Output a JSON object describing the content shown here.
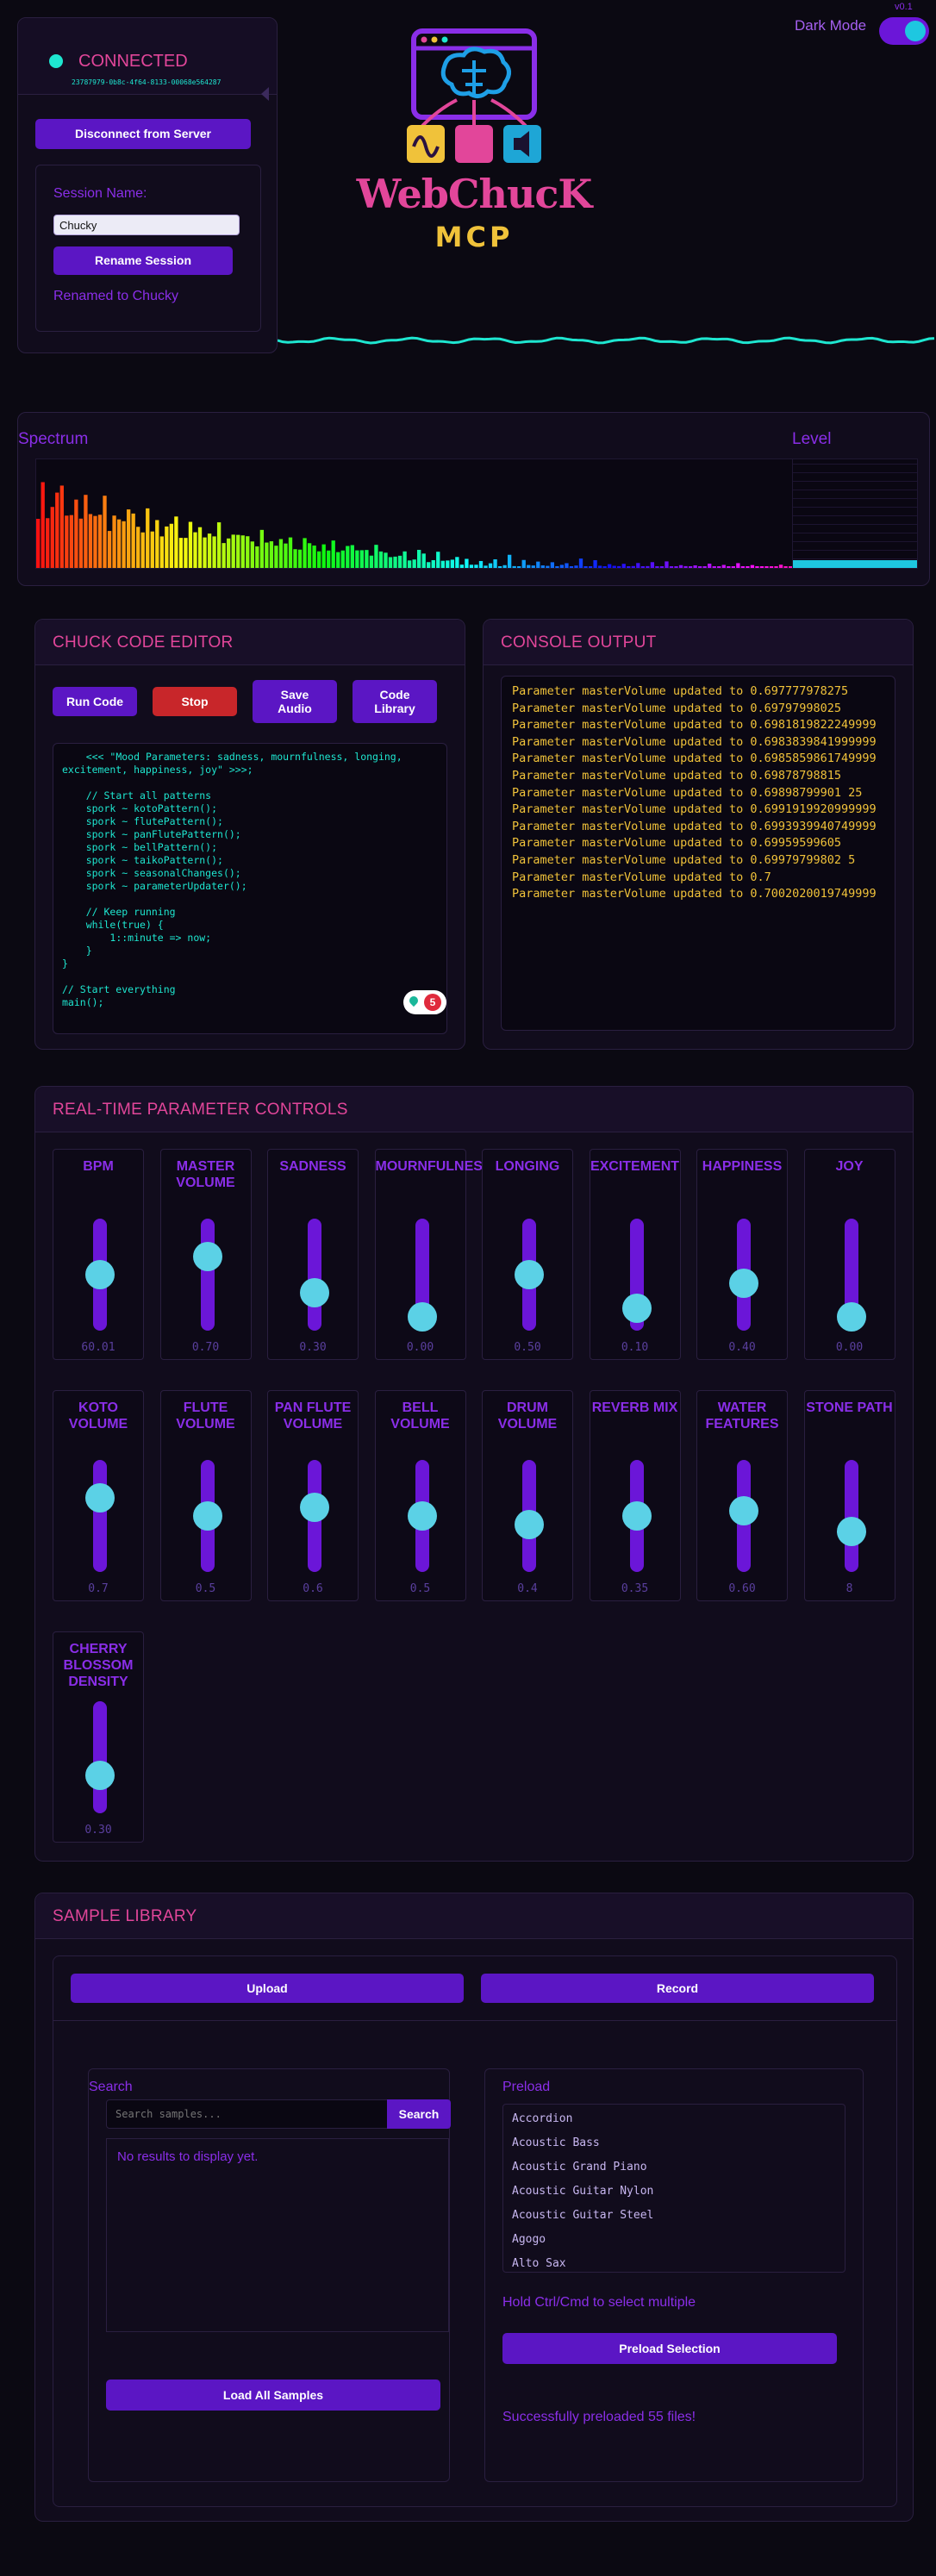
{
  "connection": {
    "status": "CONNECTED",
    "id": "23787979-0b8c-4f64-8133-00068e564287",
    "disconnect_label": "Disconnect from Server"
  },
  "session": {
    "label": "Session Name:",
    "value": "Chucky",
    "rename_label": "Rename Session",
    "message": "Renamed to Chucky"
  },
  "header": {
    "version": "v0.1",
    "dark_mode_label": "Dark Mode",
    "logo_title": "WebChucK",
    "logo_subtitle": "MCP"
  },
  "analyzers": {
    "spectrum_title": "Spectrum",
    "level_title": "Level",
    "level_value": 0.07
  },
  "editor": {
    "title": "CHUCK CODE EDITOR",
    "run_label": "Run Code",
    "stop_label": "Stop",
    "save_label": "Save Audio",
    "library_label": "Code Library",
    "code": "    <<< \"Mood Parameters: sadness, mournfulness, longing, excitement, happiness, joy\" >>>;\n\n    // Start all patterns\n    spork ~ kotoPattern();\n    spork ~ flutePattern();\n    spork ~ panFlutePattern();\n    spork ~ bellPattern();\n    spork ~ taikoPattern();\n    spork ~ seasonalChanges();\n    spork ~ parameterUpdater();\n\n    // Keep running\n    while(true) {\n        1::minute => now;\n    }\n}\n\n// Start everything\nmain();",
    "badge_count": "5"
  },
  "console": {
    "title": "CONSOLE OUTPUT",
    "lines": [
      "Parameter masterVolume updated to 0.697777978275",
      "Parameter masterVolume updated to 0.69797998025",
      "Parameter masterVolume updated to 0.6981819822249999",
      "Parameter masterVolume updated to 0.6983839841999999",
      "Parameter masterVolume updated to 0.6985859861749999",
      "Parameter masterVolume updated to 0.69878798815",
      "Parameter masterVolume updated to 0.69898799901 25",
      "Parameter masterVolume updated to 0.6991919920999999",
      "Parameter masterVolume updated to 0.6993939940749999",
      "Parameter masterVolume updated to 0.69959599605",
      "Parameter masterVolume updated to 0.69979799802 5",
      "Parameter masterVolume updated to 0.7",
      "Parameter masterVolume updated to 0.7002020019749999"
    ]
  },
  "controls": {
    "title": "REAL-TIME PARAMETER CONTROLS",
    "items": [
      {
        "label": "BPM",
        "value": "60.01",
        "level": 0.5
      },
      {
        "label": "MASTER VOLUME",
        "value": "0.70",
        "level": 0.66
      },
      {
        "label": "SADNESS",
        "value": "0.30",
        "level": 0.34
      },
      {
        "label": "MOURNFULNESS",
        "value": "0.00",
        "level": 0.12
      },
      {
        "label": "LONGING",
        "value": "0.50",
        "level": 0.5
      },
      {
        "label": "EXCITEMENT",
        "value": "0.10",
        "level": 0.2
      },
      {
        "label": "HAPPINESS",
        "value": "0.40",
        "level": 0.42
      },
      {
        "label": "JOY",
        "value": "0.00",
        "level": 0.12
      },
      {
        "label": "KOTO VOLUME",
        "value": "0.7",
        "level": 0.66
      },
      {
        "label": "FLUTE VOLUME",
        "value": "0.5",
        "level": 0.5
      },
      {
        "label": "PAN FLUTE VOLUME",
        "value": "0.6",
        "level": 0.58
      },
      {
        "label": "BELL VOLUME",
        "value": "0.5",
        "level": 0.5
      },
      {
        "label": "DRUM VOLUME",
        "value": "0.4",
        "level": 0.42
      },
      {
        "label": "REVERB MIX",
        "value": "0.35",
        "level": 0.5
      },
      {
        "label": "WATER FEATURES",
        "value": "0.60",
        "level": 0.55
      },
      {
        "label": "STONE PATH",
        "value": "8",
        "level": 0.36
      },
      {
        "label": "CHERRY BLOSSOM DENSITY",
        "value": "0.30",
        "level": 0.34
      }
    ]
  },
  "library": {
    "title": "SAMPLE LIBRARY",
    "upload_label": "Upload",
    "record_label": "Record",
    "search_title": "Search",
    "search_placeholder": "Search samples...",
    "search_button": "Search",
    "no_results": "No results to display yet.",
    "load_all_label": "Load All Samples",
    "preload_title": "Preload",
    "preload_items": [
      "Accordion",
      "Acoustic Bass",
      "Acoustic Grand Piano",
      "Acoustic Guitar Nylon",
      "Acoustic Guitar Steel",
      "Agogo",
      "Alto Sax"
    ],
    "multi_hint": "Hold Ctrl/Cmd to select multiple",
    "preload_button": "Preload Selection",
    "preload_status": "Successfully preloaded 55 files!"
  },
  "colors": {
    "accent": "#5b16c4",
    "pink": "#e2469a",
    "cyan": "#1ee6d0",
    "amber": "#f0c23a",
    "bg": "#0b0912"
  }
}
